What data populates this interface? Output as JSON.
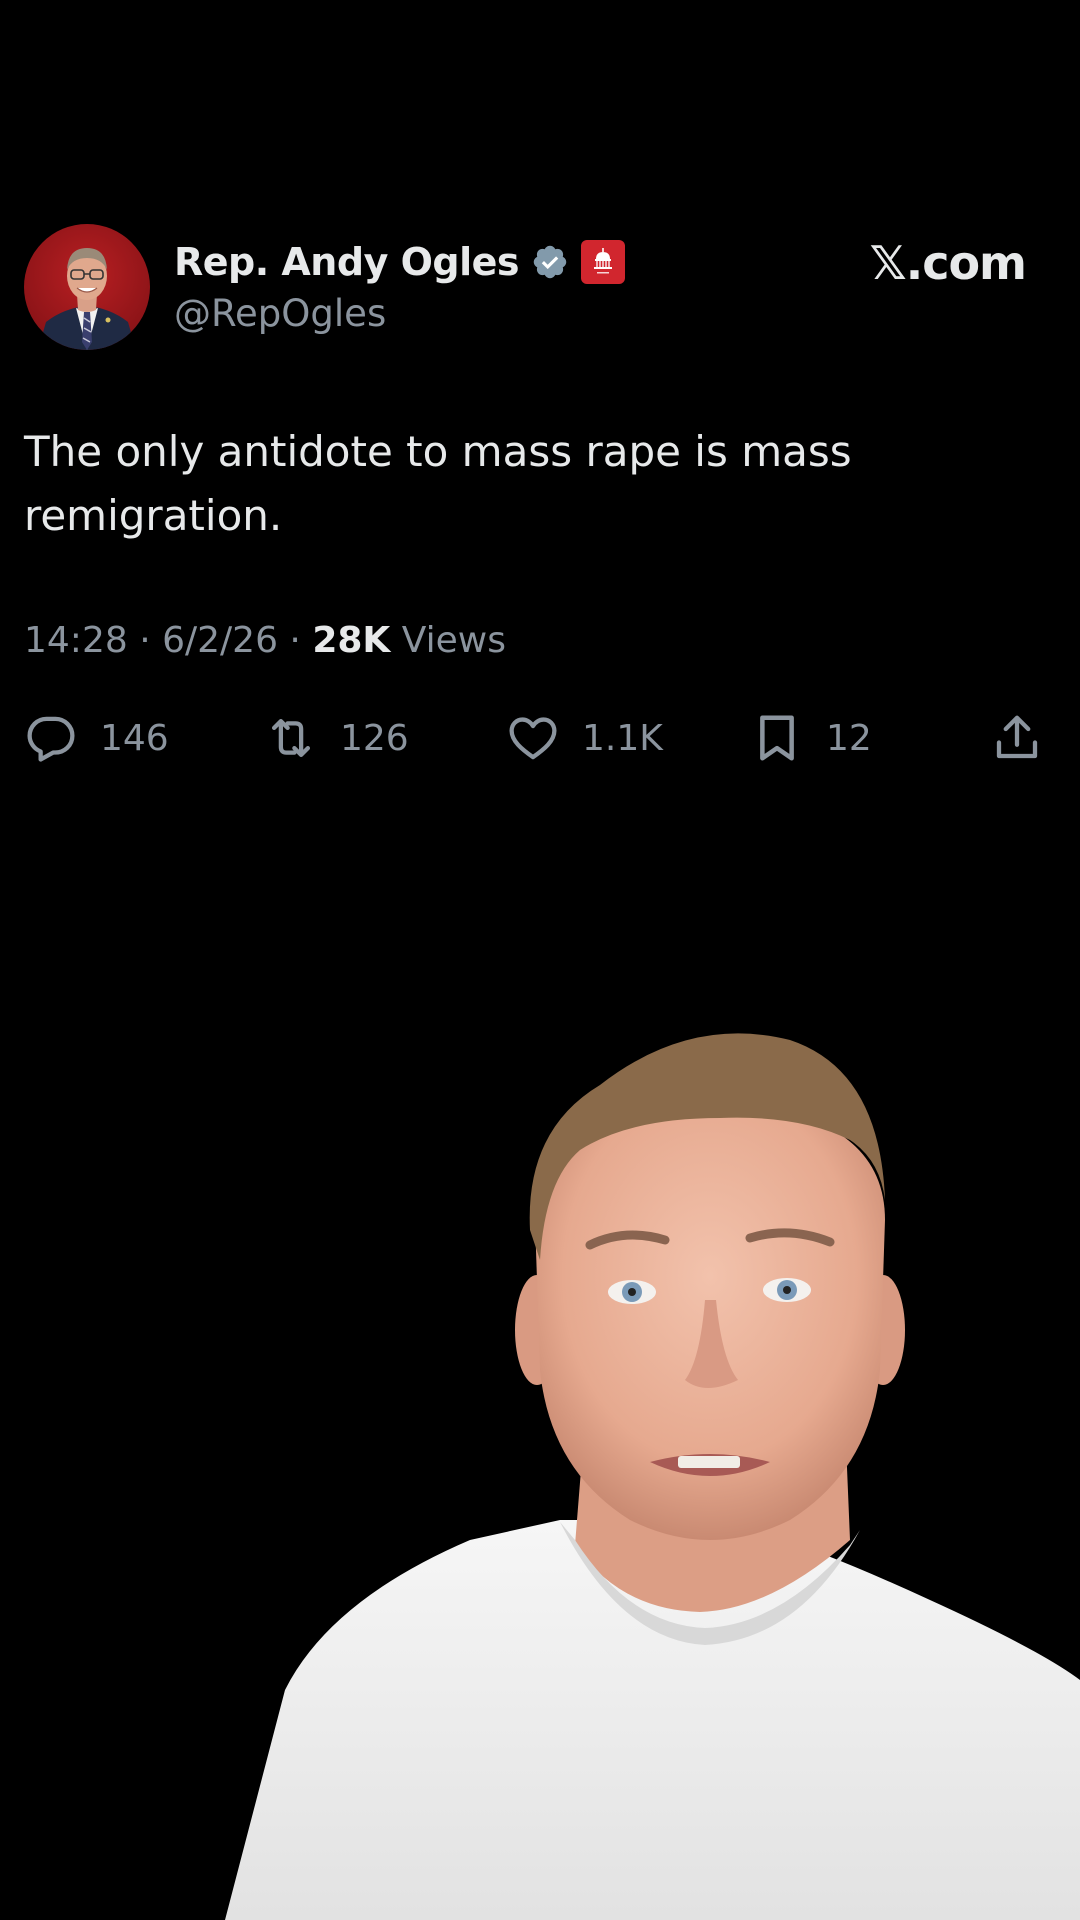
{
  "tweet": {
    "display_name": "Rep. Andy Ogles",
    "handle": "@RepOgles",
    "site": "𝕏.com",
    "text": "The only antidote to mass rape is mass remigration.",
    "time": "14:28",
    "date": "6/2/26",
    "views_count": "28K",
    "views_label": "Views",
    "badges": [
      "verified-icon",
      "government-badge-icon"
    ],
    "actions": {
      "replies": "146",
      "reposts": "126",
      "likes": "1.1K",
      "bookmarks": "12"
    }
  },
  "colors": {
    "background": "#000000",
    "text_primary": "#e7e9ea",
    "text_secondary": "#8b949e",
    "verified": "#829aab",
    "gov_badge": "#d1262e"
  }
}
